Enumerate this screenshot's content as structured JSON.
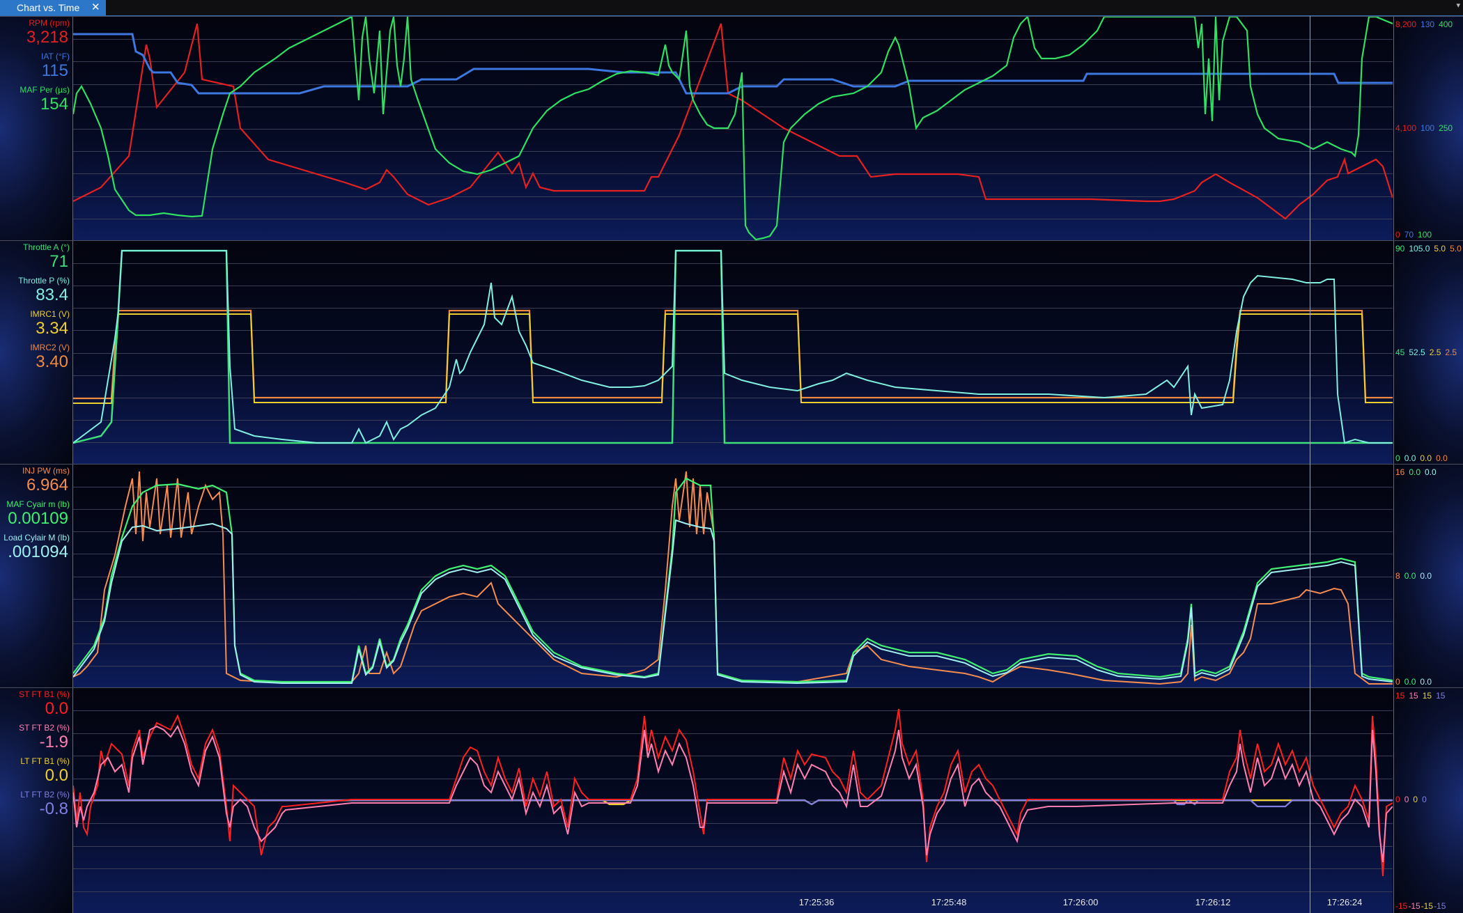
{
  "window": {
    "tab_title": "Chart vs. Time",
    "close_glyph": "✕",
    "menu_glyph": "▾"
  },
  "colors": {
    "tab": "#2d77c8",
    "rpm": "#e52020",
    "iat": "#3c78e0",
    "maf": "#30e060",
    "throttle_a": "#3ee07a",
    "throttle_p": "#80f0e0",
    "imrc1": "#f0d030",
    "imrc2": "#f08a40",
    "inj_pw": "#f58c50",
    "maf_cyl": "#40f070",
    "load_cyl": "#a0f0f0",
    "stft1": "#ff2020",
    "stft2": "#ff80b0",
    "ltft1": "#f0d030",
    "ltft2": "#8080e0"
  },
  "panels": [
    {
      "channels": [
        {
          "label": "RPM (rpm)",
          "value": "3,218",
          "color": "#e52020"
        },
        {
          "label": "IAT (°F)",
          "value": "115",
          "color": "#3c78e0"
        },
        {
          "label": "MAF Per (µs)",
          "value": "154",
          "color": "#30e060"
        }
      ],
      "scale": {
        "top": [
          {
            "text": "8,200",
            "color": "#e52020"
          },
          {
            "text": "130",
            "color": "#3c78e0"
          },
          {
            "text": "400",
            "color": "#30e060"
          }
        ],
        "mid": [
          {
            "text": "4,100",
            "color": "#e52020"
          },
          {
            "text": "100",
            "color": "#3c78e0"
          },
          {
            "text": "250",
            "color": "#30e060"
          }
        ],
        "bottom": [
          {
            "text": "0",
            "color": "#e52020"
          },
          {
            "text": "70",
            "color": "#3c78e0"
          },
          {
            "text": "100",
            "color": "#30e060"
          }
        ]
      }
    },
    {
      "channels": [
        {
          "label": "Throttle A (°)",
          "value": "71",
          "color": "#3ee07a"
        },
        {
          "label": "Throttle P (%)",
          "value": "83.4",
          "color": "#80f0e0"
        },
        {
          "label": "IMRC1 (V)",
          "value": "3.34",
          "color": "#f0d030"
        },
        {
          "label": "IMRC2 (V)",
          "value": "3.40",
          "color": "#f08a40"
        }
      ],
      "scale": {
        "top": [
          {
            "text": "90",
            "color": "#3ee07a"
          },
          {
            "text": "105.0",
            "color": "#80f0e0"
          },
          {
            "text": "5.0",
            "color": "#f0d030"
          },
          {
            "text": "5.0",
            "color": "#f08a40"
          }
        ],
        "mid": [
          {
            "text": "45",
            "color": "#3ee07a"
          },
          {
            "text": "52.5",
            "color": "#80f0e0"
          },
          {
            "text": "2.5",
            "color": "#f0d030"
          },
          {
            "text": "2.5",
            "color": "#f08a40"
          }
        ],
        "bottom": [
          {
            "text": "0",
            "color": "#3ee07a"
          },
          {
            "text": "0.0",
            "color": "#80f0e0"
          },
          {
            "text": "0.0",
            "color": "#f0d030"
          },
          {
            "text": "0.0",
            "color": "#f08a40"
          }
        ]
      }
    },
    {
      "channels": [
        {
          "label": "INJ PW (ms)",
          "value": "6.964",
          "color": "#f58c50"
        },
        {
          "label": "MAF Cyair m (lb)",
          "value": "0.00109",
          "color": "#40f070"
        },
        {
          "label": "Load Cylair M (lb)",
          "value": ".001094",
          "color": "#a0f0f0"
        }
      ],
      "scale": {
        "top": [
          {
            "text": "16",
            "color": "#f58c50"
          },
          {
            "text": "0.0",
            "color": "#40f070"
          },
          {
            "text": "0.0",
            "color": "#a0f0f0"
          }
        ],
        "mid": [
          {
            "text": "8",
            "color": "#f58c50"
          },
          {
            "text": "0.0",
            "color": "#40f070"
          },
          {
            "text": "0.0",
            "color": "#a0f0f0"
          }
        ],
        "bottom": [
          {
            "text": "0",
            "color": "#f58c50"
          },
          {
            "text": "0.0",
            "color": "#40f070"
          },
          {
            "text": "0.0",
            "color": "#a0f0f0"
          }
        ]
      }
    },
    {
      "channels": [
        {
          "label": "ST FT B1 (%)",
          "value": "0.0",
          "color": "#ff2020"
        },
        {
          "label": "ST FT B2 (%)",
          "value": "-1.9",
          "color": "#ff80b0"
        },
        {
          "label": "LT FT B1 (%)",
          "value": "0.0",
          "color": "#f0d030"
        },
        {
          "label": "LT FT B2 (%)",
          "value": "-0.8",
          "color": "#8080e0"
        }
      ],
      "scale": {
        "top": [
          {
            "text": "15",
            "color": "#ff2020"
          },
          {
            "text": "15",
            "color": "#ff80b0"
          },
          {
            "text": "15",
            "color": "#f0d030"
          },
          {
            "text": "15",
            "color": "#8080e0"
          }
        ],
        "mid": [
          {
            "text": "0",
            "color": "#ff2020"
          },
          {
            "text": "0",
            "color": "#ff80b0"
          },
          {
            "text": "0",
            "color": "#f0d030"
          },
          {
            "text": "0",
            "color": "#8080e0"
          }
        ],
        "bottom": [
          {
            "text": "-15",
            "color": "#ff2020"
          },
          {
            "text": "-15",
            "color": "#ff80b0"
          },
          {
            "text": "-15",
            "color": "#f0d030"
          },
          {
            "text": "-15",
            "color": "#8080e0"
          }
        ]
      }
    }
  ],
  "time_axis": {
    "ticks": [
      "17:25:36",
      "17:25:48",
      "17:26:00",
      "17:26:12",
      "17:26:24"
    ]
  }
}
